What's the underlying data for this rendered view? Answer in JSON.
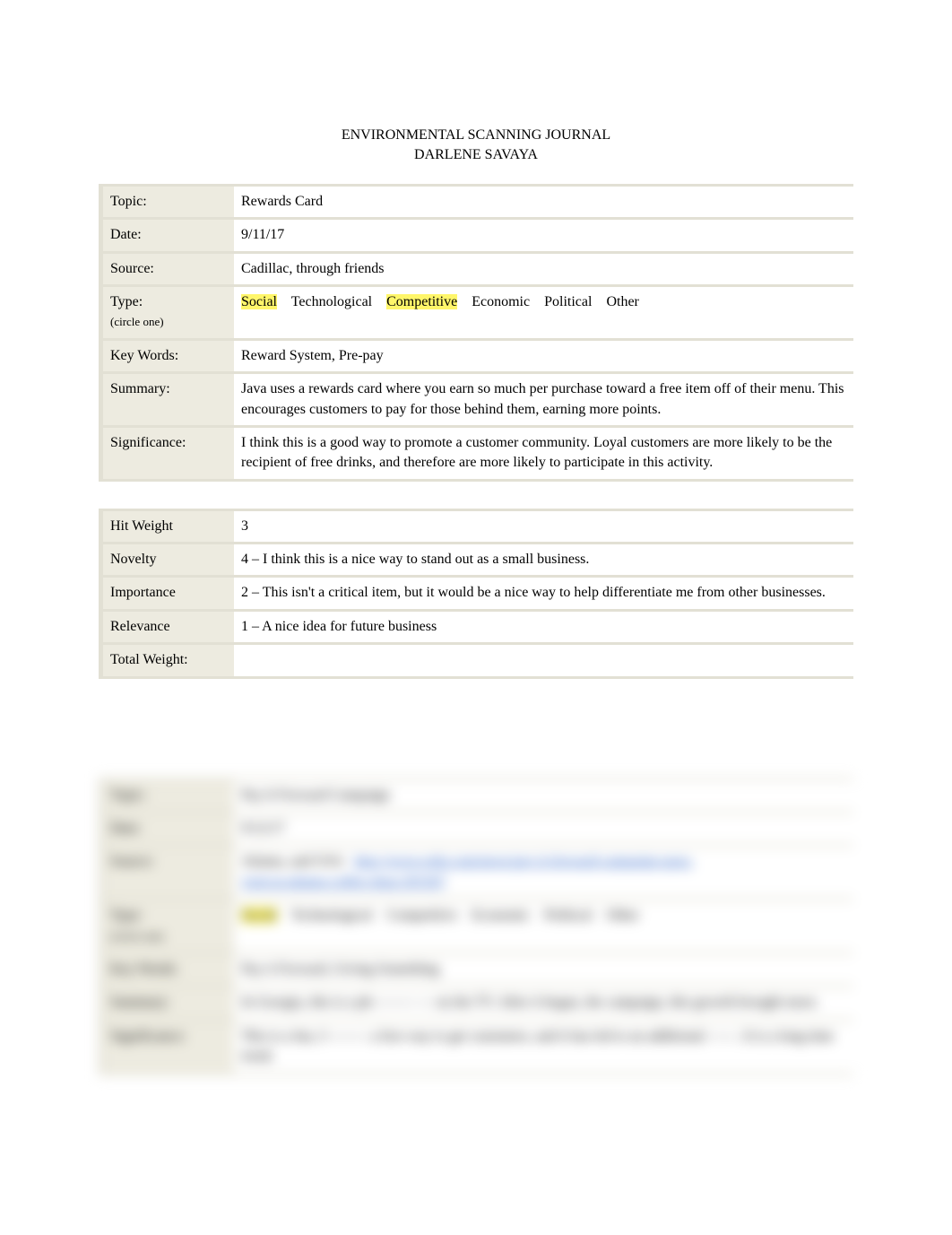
{
  "heading": {
    "title": "ENVIRONMENTAL SCANNING JOURNAL",
    "author": "DARLENE SAVAYA"
  },
  "entry1": {
    "rows": {
      "topic": {
        "label": "Topic:",
        "value": "Rewards Card"
      },
      "date": {
        "label": "Date:",
        "value": "9/11/17"
      },
      "source": {
        "label": "Source:",
        "value": "Cadillac, through friends"
      },
      "type": {
        "label1": "Type:",
        "label2": "(circle one)",
        "options": {
          "social": "Social",
          "technological": "Technological",
          "competitive": "Competitive",
          "economic": "Economic",
          "political": "Political",
          "other": "Other"
        }
      },
      "keywords": {
        "label": "Key Words:",
        "value": "Reward System, Pre-pay"
      },
      "summary": {
        "label": "Summary:",
        "value": "Java uses a rewards card where you earn so much per purchase toward a free item off of their menu.    This encourages customers to pay for those behind them, earning more points."
      },
      "significance": {
        "label": "Significance:",
        "value": "I think this is a good way to promote a customer community.        Loyal customers are more likely to be the recipient of free drinks, and therefore are more likely to participate in this activity."
      }
    }
  },
  "weights": {
    "hit": {
      "label": "Hit Weight",
      "value": "3"
    },
    "novelty": {
      "label": "Novelty",
      "value": "4 – I think this is a nice way to stand out as a small business."
    },
    "importance": {
      "label": "Importance",
      "value": "2 – This isn't a critical item, but it would be a nice way to help differentiate me from other businesses."
    },
    "relevance": {
      "label": "Relevance",
      "value": "1 – A nice idea for future business"
    },
    "total": {
      "label": "Total Weight:",
      "value": ""
    }
  },
  "entry2": {
    "rows": {
      "topic": {
        "label": "Topic:",
        "value": "Pay It Forward Campaign"
      },
      "date": {
        "label": "Date:",
        "value": "9/12/17"
      },
      "source": {
        "label": "Source:",
        "part1": "Atlanta, and USA",
        "link": "http://www.wtkr.com/news/pay-it-forward-campaign-goes-",
        "part2": "viral-at-atlanta-coffee-shop-291567"
      },
      "type": {
        "label1": "Type:",
        "label2": "(circle one)",
        "options": {
          "social": "Social",
          "technological": "Technological",
          "competitive": "Competitive",
          "economic": "Economic",
          "political": "Political",
          "other": "Other"
        }
      },
      "keywords": {
        "label": "Key Words:",
        "value": "Pay it Forward, Giving Something"
      },
      "summary": {
        "label": "Summary:",
        "value": "In Georgia, this is a ph——— — on the TV.  After it began, the campaign, this growth brought more."
      },
      "significance": {
        "label": "Significance:",
        "value": "This is a fun, f——— a free way to get customers, and it has led to an additional ——. It is a long time trend."
      }
    }
  }
}
